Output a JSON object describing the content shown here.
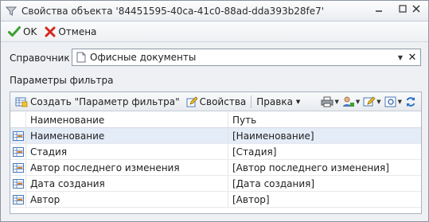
{
  "window": {
    "title": "Свойства объекта '84451595-40ca-41c0-88ad-dda393b28fe7'"
  },
  "commands": {
    "ok_label": "OK",
    "cancel_label": "Отмена"
  },
  "directory": {
    "label": "Справочник",
    "value": "Офисные документы"
  },
  "filter_section": {
    "label": "Параметры фильтра"
  },
  "toolbar": {
    "create_label": "Создать \"Параметр фильтра\"",
    "properties_label": "Свойства",
    "edit_label": "Правка"
  },
  "grid": {
    "columns": [
      "Наименование",
      "Путь"
    ],
    "rows": [
      {
        "name": "Наименование",
        "path": "[Наименование]"
      },
      {
        "name": "Стадия",
        "path": "[Стадия]"
      },
      {
        "name": "Автор последнего изменения",
        "path": "[Автор последнего изменения]"
      },
      {
        "name": "Дата создания",
        "path": "[Дата создания]"
      },
      {
        "name": "Автор",
        "path": "[Автор]"
      }
    ],
    "selected_row": 0
  },
  "colors": {
    "selection": "#e4ecf8",
    "accent": "#2a6fc9"
  }
}
